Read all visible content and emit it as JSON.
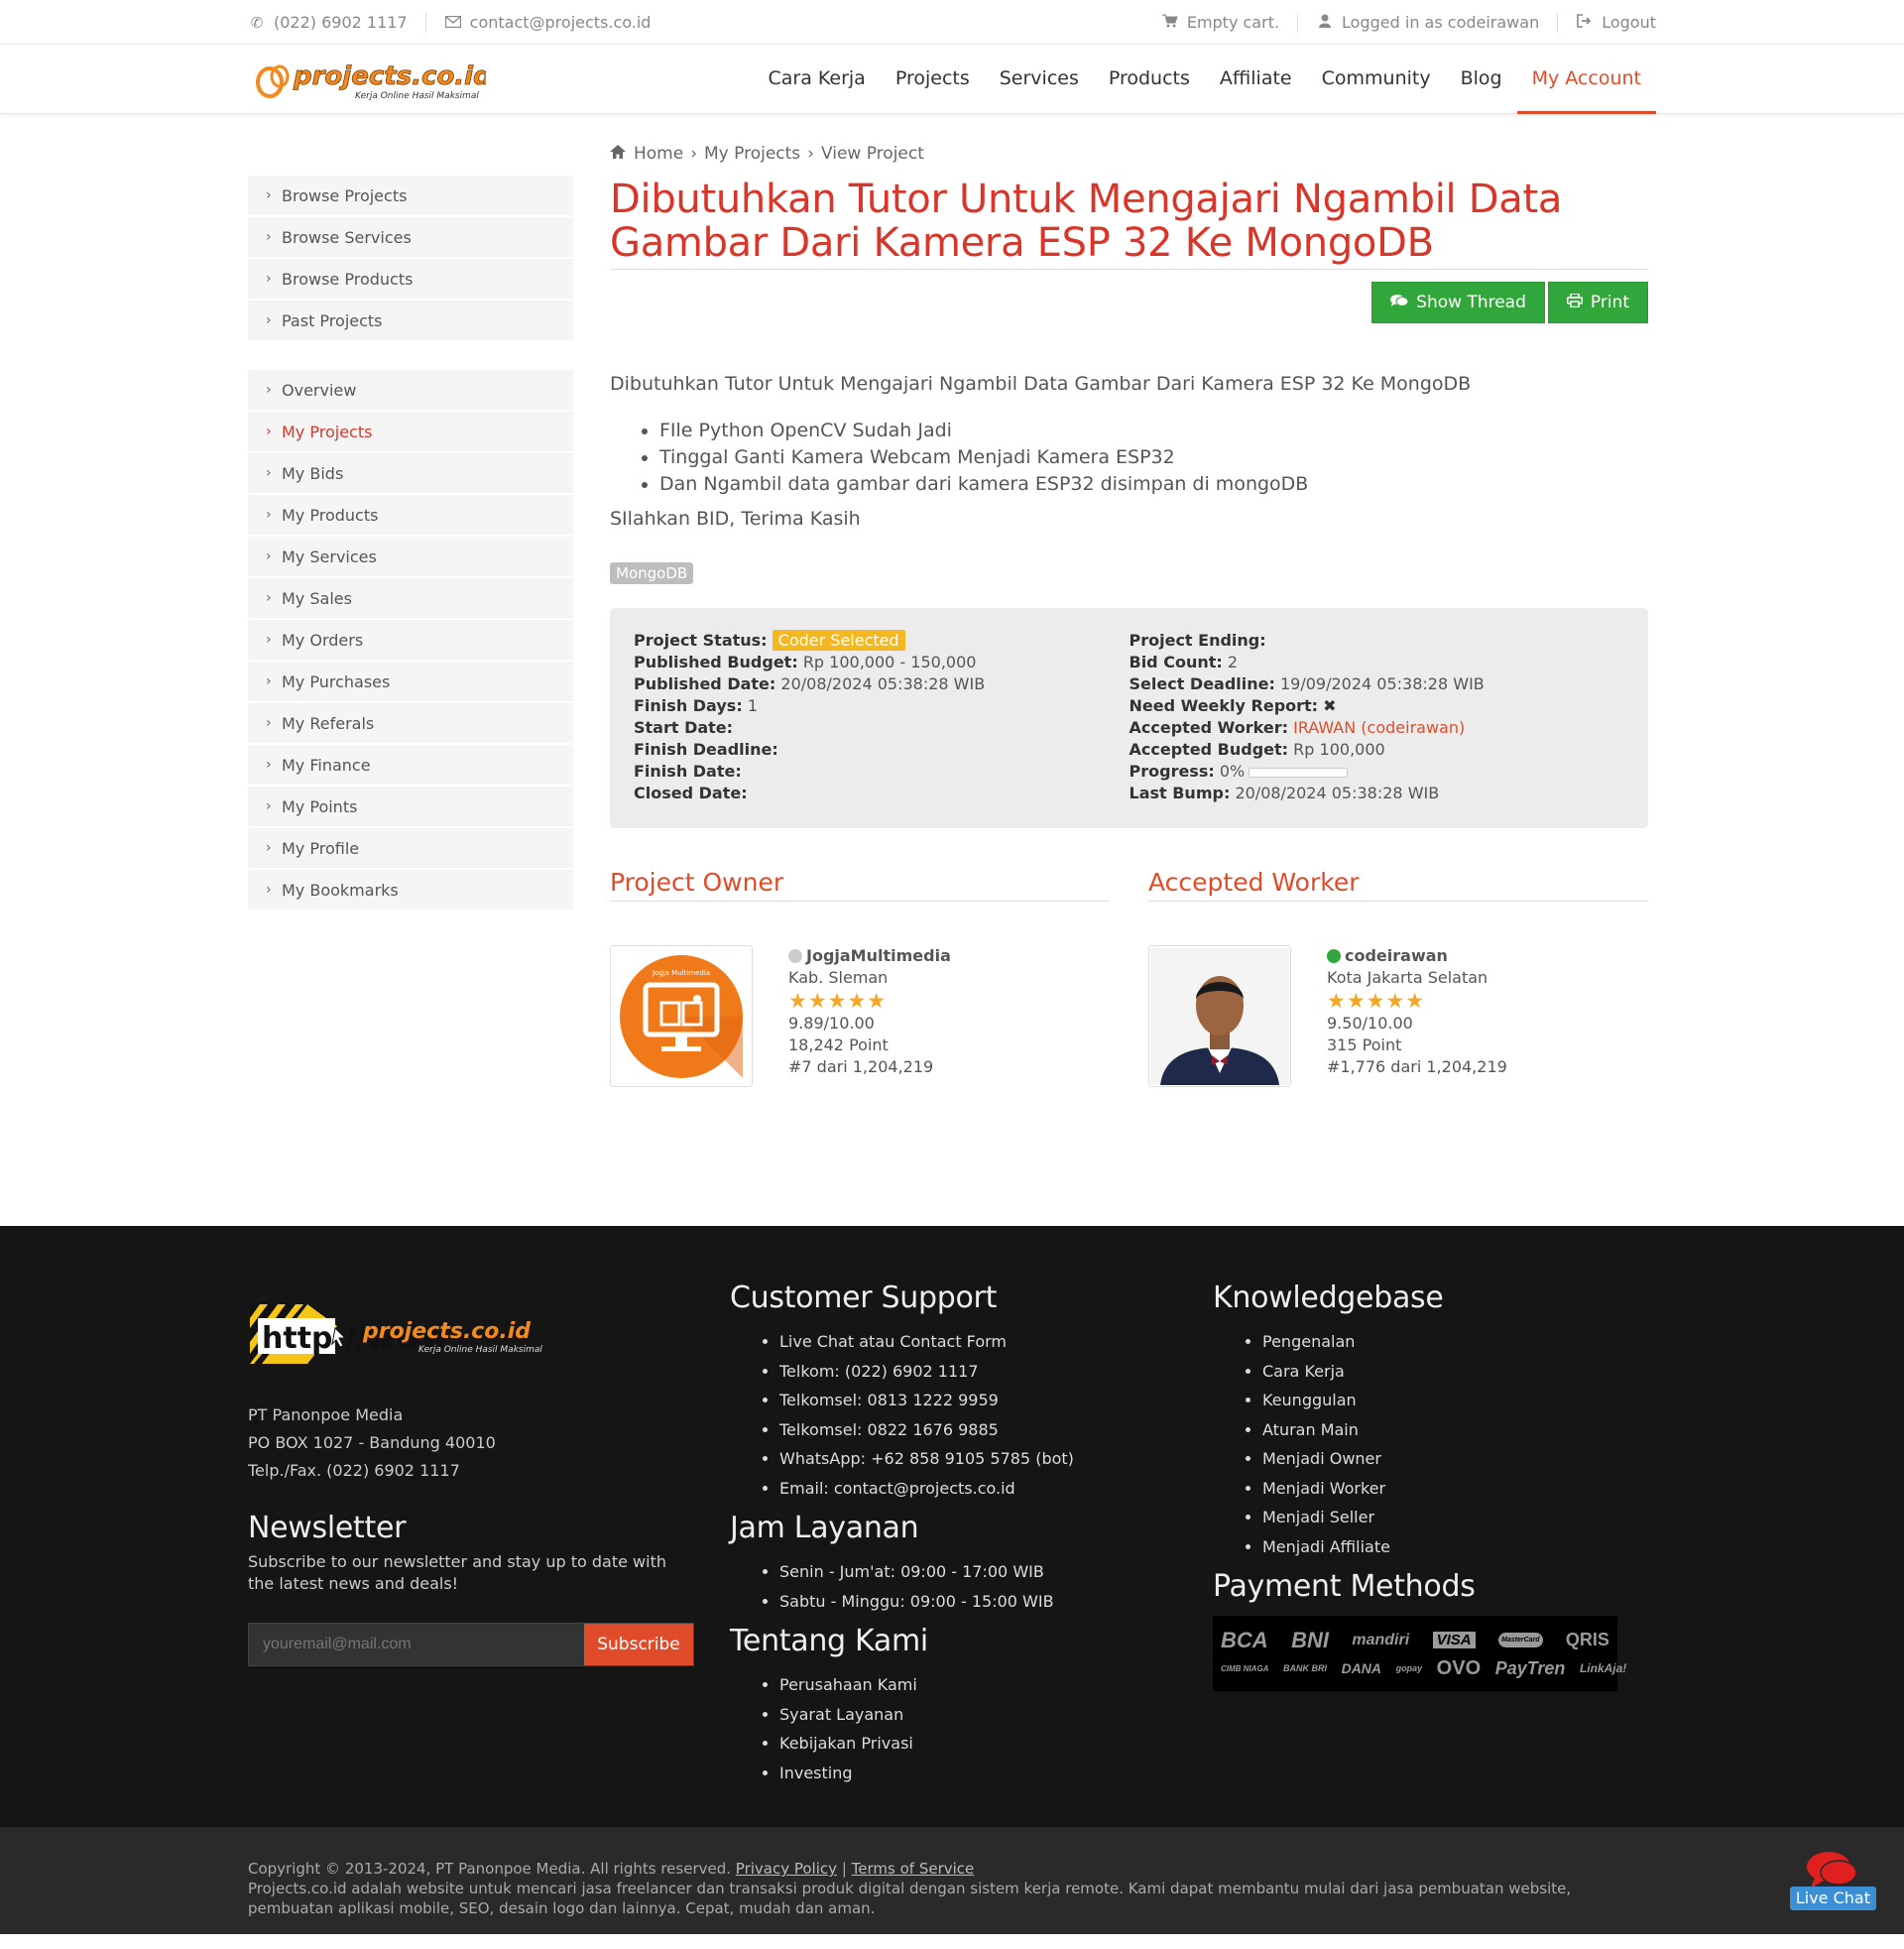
{
  "topbar": {
    "phone": "(022) 6902 1117",
    "email": "contact@projects.co.id",
    "cart": "Empty cart.",
    "user": "Logged in as codeirawan",
    "logout": "Logout"
  },
  "brand": {
    "logo_text": "projects.co.id",
    "tagline": "Kerja Online Hasil Maksimal"
  },
  "nav": {
    "items": [
      {
        "label": "Cara Kerja"
      },
      {
        "label": "Projects"
      },
      {
        "label": "Services"
      },
      {
        "label": "Products"
      },
      {
        "label": "Affiliate"
      },
      {
        "label": "Community"
      },
      {
        "label": "Blog"
      },
      {
        "label": "My Account"
      }
    ]
  },
  "sidebar": {
    "group1": [
      {
        "label": "Browse Projects"
      },
      {
        "label": "Browse Services"
      },
      {
        "label": "Browse Products"
      },
      {
        "label": "Past Projects"
      }
    ],
    "group2": [
      {
        "label": "Overview"
      },
      {
        "label": "My Projects"
      },
      {
        "label": "My Bids"
      },
      {
        "label": "My Products"
      },
      {
        "label": "My Services"
      },
      {
        "label": "My Sales"
      },
      {
        "label": "My Orders"
      },
      {
        "label": "My Purchases"
      },
      {
        "label": "My Referals"
      },
      {
        "label": "My Finance"
      },
      {
        "label": "My Points"
      },
      {
        "label": "My Profile"
      },
      {
        "label": "My Bookmarks"
      }
    ]
  },
  "breadcrumb": {
    "home": "Home",
    "projects": "My Projects",
    "current": "View Project"
  },
  "project": {
    "title": "Dibutuhkan Tutor Untuk Mengajari Ngambil Data Gambar Dari Kamera ESP 32 Ke MongoDB",
    "show_thread": "Show Thread",
    "print": "Print",
    "intro": "Dibutuhkan Tutor Untuk Mengajari Ngambil Data Gambar Dari Kamera ESP 32 Ke MongoDB",
    "bullets": [
      "FIle Python OpenCV Sudah Jadi",
      "Tinggal Ganti Kamera Webcam Menjadi Kamera ESP32",
      "Dan Ngambil data gambar dari kamera ESP32 disimpan di mongoDB"
    ],
    "closing": "SIlahkan BID, Terima Kasih",
    "tag": "MongoDB"
  },
  "details": {
    "status_label": "Project Status:",
    "status_value": "Coder Selected",
    "budget_label": "Published Budget:",
    "budget_value": "Rp 100,000 - 150,000",
    "published_label": "Published Date:",
    "published_value": "20/08/2024 05:38:28 WIB",
    "finish_days_label": "Finish Days:",
    "finish_days_value": "1",
    "start_label": "Start Date:",
    "finish_deadline_label": "Finish Deadline:",
    "finish_date_label": "Finish Date:",
    "closed_label": "Closed Date:",
    "ending_label": "Project Ending:",
    "bid_count_label": "Bid Count:",
    "bid_count_value": "2",
    "select_deadline_label": "Select Deadline:",
    "select_deadline_value": "19/09/2024 05:38:28 WIB",
    "weekly_label": "Need Weekly Report:",
    "weekly_value": "✖",
    "worker_label": "Accepted Worker:",
    "worker_value": "IRAWAN (codeirawan)",
    "accepted_budget_label": "Accepted Budget:",
    "accepted_budget_value": "Rp 100,000",
    "progress_label": "Progress:",
    "progress_value": "0%",
    "progress_fraction": 0,
    "bump_label": "Last Bump:",
    "bump_value": "20/08/2024 05:38:28 WIB"
  },
  "owner": {
    "heading": "Project Owner",
    "avatar_text": "Jogja Multimedia",
    "name": "JogjaMultimedia",
    "location": "Kab. Sleman",
    "rating_stars": 5,
    "score": "9.89/10.00",
    "points": "18,242 Point",
    "rank": "#7 dari 1,204,219",
    "online_color": "#cccccc"
  },
  "worker": {
    "heading": "Accepted Worker",
    "name": "codeirawan",
    "location": "Kota Jakarta Selatan",
    "rating_stars": 5,
    "score": "9.50/10.00",
    "points": "315 Point",
    "rank": "#1,776 dari 1,204,219",
    "online_color": "#31a63a"
  },
  "footer": {
    "logo_http": "http://www",
    "company": "PT Panonpoe Media",
    "po_box": "PO BOX 1027 - Bandung 40010",
    "telp": "Telp./Fax. (022) 6902 1117",
    "newsletter_title": "Newsletter",
    "newsletter_text": "Subscribe to our newsletter and stay up to date with the latest news and deals!",
    "newsletter_placeholder": "youremail@mail.com",
    "subscribe": "Subscribe",
    "support_title": "Customer Support",
    "support": [
      "Live Chat atau Contact Form",
      "Telkom: (022) 6902 1117",
      "Telkomsel: 0813 1222 9959",
      "Telkomsel: 0822 1676 9885",
      "WhatsApp: +62 858 9105 5785 (bot)",
      "Email: contact@projects.co.id"
    ],
    "hours_title": "Jam Layanan",
    "hours": [
      "Senin - Jum'at: 09:00 - 17:00 WIB",
      "Sabtu - Minggu: 09:00 - 15:00 WIB"
    ],
    "about_title": "Tentang Kami",
    "about": [
      "Perusahaan Kami",
      "Syarat Layanan",
      "Kebijakan Privasi",
      "Investing"
    ],
    "kb_title": "Knowledgebase",
    "kb": [
      "Pengenalan",
      "Cara Kerja",
      "Keunggulan",
      "Aturan Main",
      "Menjadi Owner",
      "Menjadi Worker",
      "Menjadi Seller",
      "Menjadi Affiliate"
    ],
    "pay_title": "Payment Methods",
    "pay_row1": [
      "BCA",
      "BNI",
      "mandiri",
      "VISA",
      "MasterCard",
      "QRIS"
    ],
    "pay_row2": [
      "CIMB NIAGA",
      "BANK BRI",
      "DANA",
      "gopay",
      "OVO",
      "PayTren",
      "LinkAja!"
    ]
  },
  "copyright": {
    "text": "Copyright © 2013-2024, PT Panonpoe Media. All rights reserved.",
    "privacy": "Privacy Policy",
    "sep": "|",
    "terms": "Terms of Service",
    "about": "Projects.co.id adalah website untuk mencari jasa freelancer dan transaksi produk digital dengan sistem kerja remote. Kami dapat membantu mulai dari jasa pembuatan website, pembuatan aplikasi mobile, SEO, desain logo dan lainnya. Cepat, mudah dan aman."
  },
  "livechat": {
    "label": "Live Chat"
  },
  "colors": {
    "accent": "#e04c2a",
    "title_red": "#d9362a",
    "green": "#31a63a",
    "badge": "#f5b71e"
  }
}
